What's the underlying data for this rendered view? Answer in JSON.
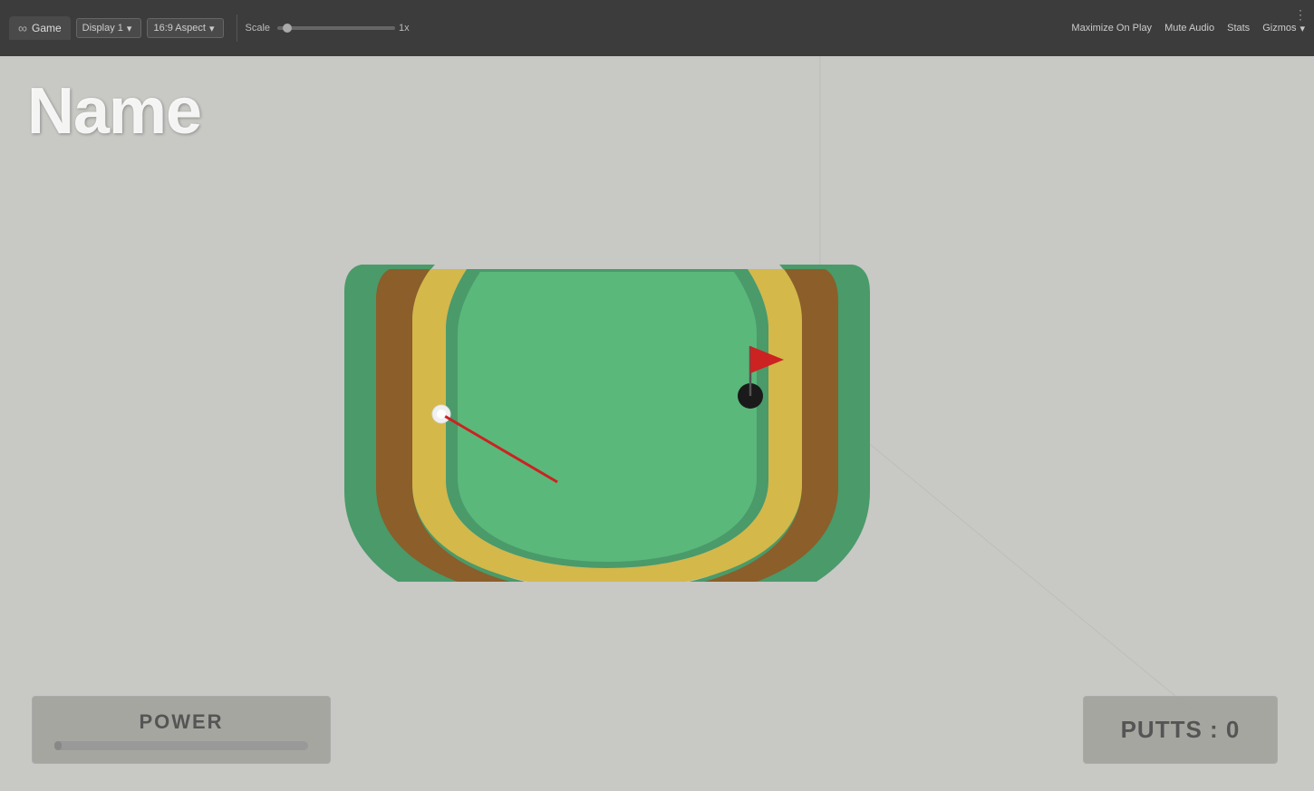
{
  "toolbar": {
    "tab_label": "Game",
    "infinity_icon": "∞",
    "display_label": "Display 1",
    "aspect_label": "16:9 Aspect",
    "scale_label": "Scale",
    "scale_value": "1x",
    "maximize_label": "Maximize On Play",
    "mute_label": "Mute Audio",
    "stats_label": "Stats",
    "gizmos_label": "Gizmos",
    "dots_icon": "⋮"
  },
  "game": {
    "name_label": "Name",
    "power_label": "POWER",
    "putts_label": "PUTTS :  0",
    "power_fill_pct": 3
  },
  "colors": {
    "toolbar_bg": "#3c3c3c",
    "game_bg": "#c8c8c4",
    "green_outer": "#4a9a6a",
    "green_inner": "#5ab87a",
    "fairway": "#d4b84a",
    "border_brown": "#8B5E2A",
    "hole": "#1a1a1a",
    "flag_red": "#cc2222",
    "ball_white": "#f0f0f0"
  }
}
